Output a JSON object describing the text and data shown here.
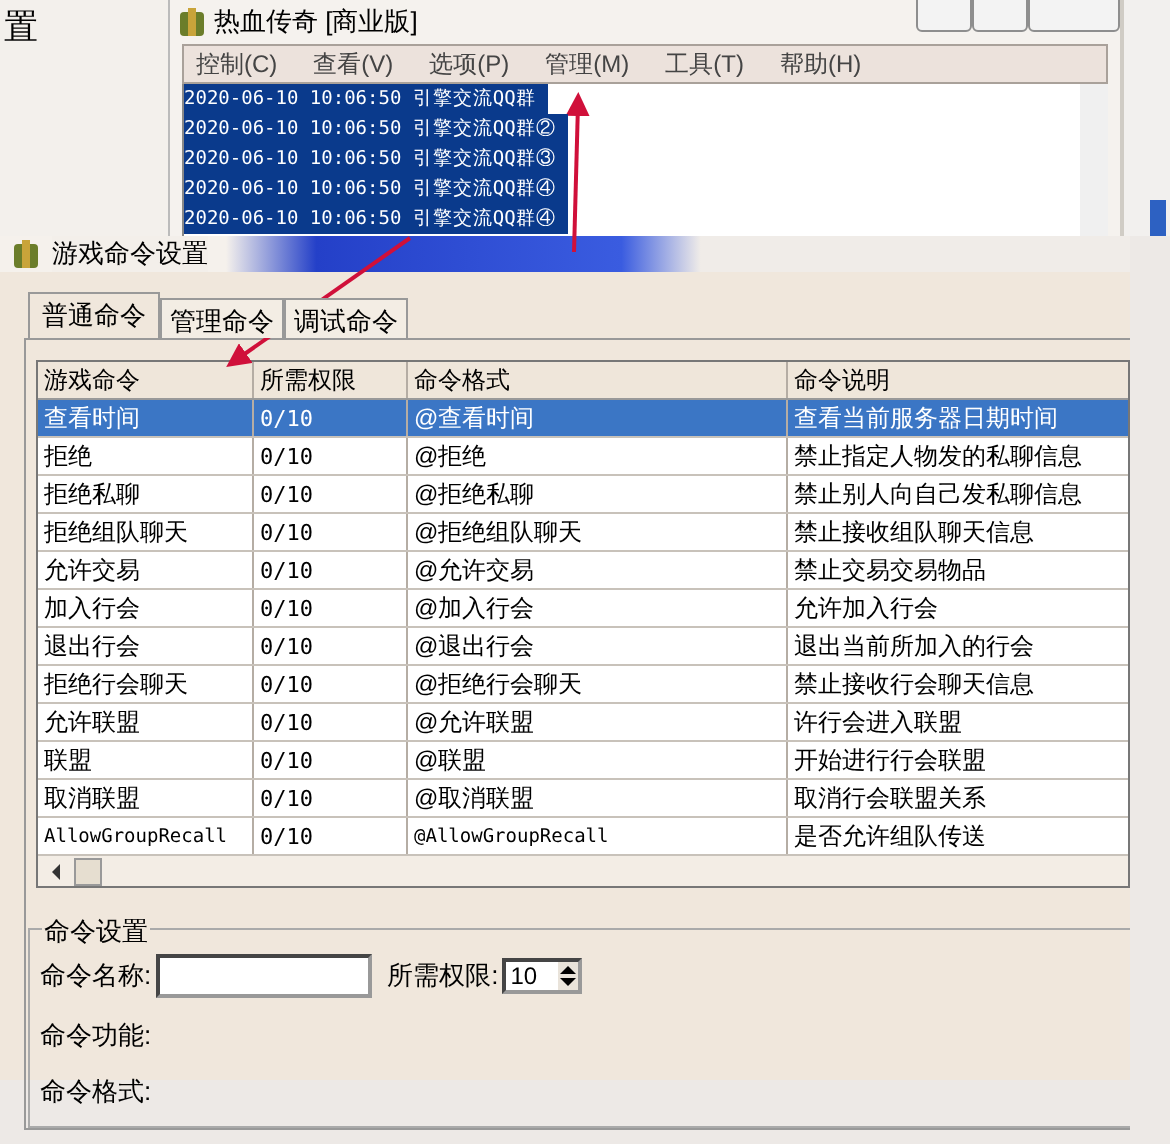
{
  "side_window": {
    "title_fragment": "置"
  },
  "main_window": {
    "title": "热血传奇 [商业版]",
    "menu": [
      "控制(C)",
      "查看(V)",
      "选项(P)",
      "管理(M)",
      "工具(T)",
      "帮助(H)"
    ],
    "log_lines": [
      "2020-06-10 10:06:50 引擎交流QQ群",
      "2020-06-10 10:06:50 引擎交流QQ群②",
      "2020-06-10 10:06:50 引擎交流QQ群③",
      "2020-06-10 10:06:50 引擎交流QQ群④",
      "2020-06-10 10:06:50 引擎交流QQ群④"
    ]
  },
  "dialog": {
    "title": "游戏命令设置",
    "tabs": [
      {
        "label": "普通命令",
        "selected": true
      },
      {
        "label": "管理命令",
        "selected": false
      },
      {
        "label": "调试命令",
        "selected": false
      }
    ],
    "table": {
      "columns": [
        "游戏命令",
        "所需权限",
        "命令格式",
        "命令说明"
      ],
      "rows": [
        {
          "cells": [
            "查看时间",
            "0/10",
            "@查看时间",
            "查看当前服务器日期时间"
          ],
          "selected": true
        },
        {
          "cells": [
            "拒绝",
            "0/10",
            "@拒绝",
            "禁止指定人物发的私聊信息"
          ],
          "selected": false
        },
        {
          "cells": [
            "拒绝私聊",
            "0/10",
            "@拒绝私聊",
            "禁止别人向自己发私聊信息"
          ],
          "selected": false
        },
        {
          "cells": [
            "拒绝组队聊天",
            "0/10",
            "@拒绝组队聊天",
            "禁止接收组队聊天信息"
          ],
          "selected": false
        },
        {
          "cells": [
            "允许交易",
            "0/10",
            "@允许交易",
            "禁止交易交易物品"
          ],
          "selected": false
        },
        {
          "cells": [
            "加入行会",
            "0/10",
            "@加入行会",
            "允许加入行会"
          ],
          "selected": false
        },
        {
          "cells": [
            "退出行会",
            "0/10",
            "@退出行会",
            "退出当前所加入的行会"
          ],
          "selected": false
        },
        {
          "cells": [
            "拒绝行会聊天",
            "0/10",
            "@拒绝行会聊天",
            "禁止接收行会聊天信息"
          ],
          "selected": false
        },
        {
          "cells": [
            "允许联盟",
            "0/10",
            "@允许联盟",
            "许行会进入联盟"
          ],
          "selected": false
        },
        {
          "cells": [
            "联盟",
            "0/10",
            "@联盟",
            "开始进行行会联盟"
          ],
          "selected": false
        },
        {
          "cells": [
            "取消联盟",
            "0/10",
            "@取消联盟",
            "取消行会联盟关系"
          ],
          "selected": false
        },
        {
          "cells": [
            "AllowGroupRecall",
            "0/10",
            "@AllowGroupRecall",
            "是否允许组队传送"
          ],
          "selected": false
        }
      ]
    },
    "settings": {
      "title": "命令设置",
      "name_label": "命令名称:",
      "permission_label": "所需权限:",
      "permission_value": "10",
      "function_label": "命令功能:",
      "format_label": "命令格式:"
    }
  }
}
